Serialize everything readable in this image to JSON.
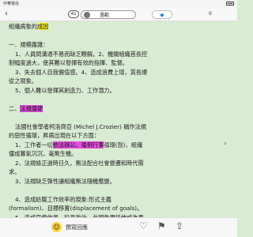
{
  "status": {
    "carrier": "中華電信",
    "time": "",
    "battery": ""
  },
  "top": {
    "back_glyph": "‹",
    "badge": "4G",
    "pill_label": "過範",
    "count": "0"
  },
  "content": {
    "lines": [
      "組織病象的成因",
      "一．規模龐雜：",
      "1、人員間溝通不易而缺乏瞭解。2、機關組織首長控",
      "制幅度過大，使其難以發揮有效的指揮、監督。",
      "3、失去個人自我價值感。4、造成浪費上增，質長爆",
      "從之現象。",
      "5、個人難以發揮其創造力、工作潛力。",
      "二、",
      "法國社會學者柯洛齊亞 (Michel J.Crozier) 稱作法規",
      "的惡性循環，昇病出現在以下方面：",
      "1、工作者一切",
      "循環(剖)，組織",
      "僵成暮氣沉沉，毫無生機。",
      "2、法規條正過時日久，無法配合社會變遷和時代需",
      "求。",
      "3、法規缺乏彈性讓組織無法隨機應變。",
      "4、造成紡寵工作效率的現象:形式主義",
      "(formalism)、目標移置(displacement of goals)。",
      "5、造成官僚作風、科員政治，此現象更延伸成為責"
    ],
    "highlight_yellow": "成因",
    "highlight_heading": "法規僵硬",
    "highlight_inline": "依法辦公，循例行事"
  },
  "bottom": {
    "reply_label": "撰寫回應"
  }
}
